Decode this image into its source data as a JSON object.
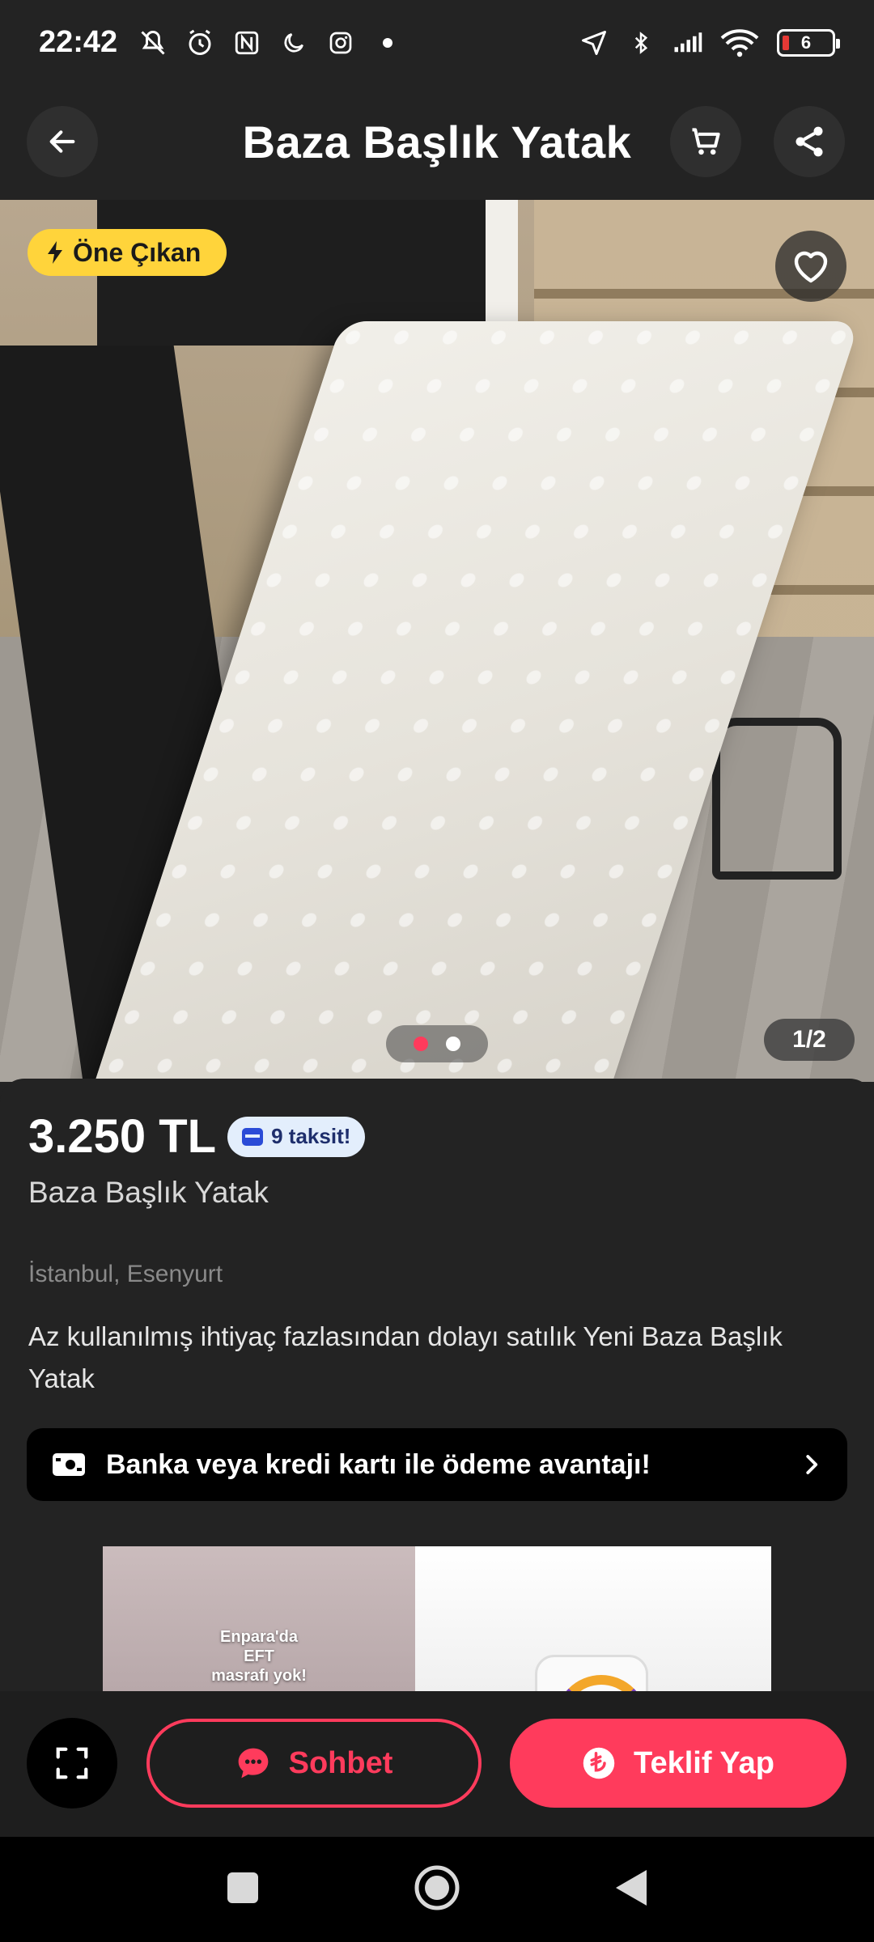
{
  "status_bar": {
    "time": "22:42",
    "battery_level": "6",
    "icons_left": [
      "mute-icon",
      "alarm-icon",
      "nfc-icon",
      "moon-icon",
      "instagram-icon",
      "dot-icon"
    ],
    "icons_right": [
      "location-arrow-icon",
      "bluetooth-icon",
      "signal-icon",
      "wifi-icon",
      "battery-icon"
    ]
  },
  "header": {
    "title": "Baza Başlık Yatak"
  },
  "gallery": {
    "badge_label": "Öne Çıkan",
    "counter": "1/2",
    "current_index": 1,
    "total": 2
  },
  "listing": {
    "price": "3.250 TL",
    "installment_label": "9 taksit!",
    "title": "Baza Başlık Yatak",
    "location": "İstanbul, Esenyurt",
    "description": "Az kullanılmış ihtiyaç fazlasından dolayı satılık Yeni Baza Başlık Yatak"
  },
  "bank_banner": {
    "text": "Banka veya kredi kartı ile ödeme avantajı!"
  },
  "ad": {
    "left_text_line1": "Enpara'da",
    "left_text_line2": "EFT",
    "left_text_line3": "masrafı yok!"
  },
  "actions": {
    "chat_label": "Sohbet",
    "offer_label": "Teklif Yap"
  },
  "colors": {
    "accent": "#ff3b5c",
    "badge": "#ffd43b",
    "background": "#232323"
  }
}
